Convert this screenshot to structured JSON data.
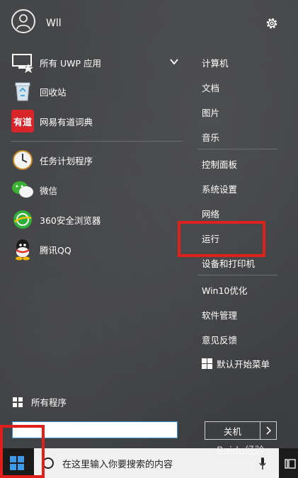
{
  "user": {
    "name": "Wll"
  },
  "apps": [
    {
      "label": "所有 UWP 应用",
      "icon": "uwp-apps-icon"
    },
    {
      "label": "回收站",
      "icon": "recycle-bin-icon"
    },
    {
      "label": "网易有道词典",
      "icon": "youdao-icon",
      "icon_text": "有道"
    },
    {
      "label": "任务计划程序",
      "icon": "task-scheduler-icon"
    },
    {
      "label": "微信",
      "icon": "wechat-icon"
    },
    {
      "label": "360安全浏览器",
      "icon": "360-browser-icon"
    },
    {
      "label": "腾讯QQ",
      "icon": "qq-icon"
    }
  ],
  "right_items": [
    "计算机",
    "文档",
    "图片",
    "音乐",
    "控制面板",
    "系统设置",
    "网络",
    "运行",
    "设备和打印机",
    "Win10优化",
    "软件管理",
    "意见反馈",
    "默认开始菜单"
  ],
  "all_programs": "所有程序",
  "shutdown": {
    "label": "关机"
  },
  "taskbar": {
    "search_placeholder": "在这里输入你要搜索的内容"
  },
  "watermark": "Baidu经验",
  "colors": {
    "highlight": "#e0201b",
    "youdao": "#d8252a",
    "taskbar": "#1b1b1c"
  }
}
